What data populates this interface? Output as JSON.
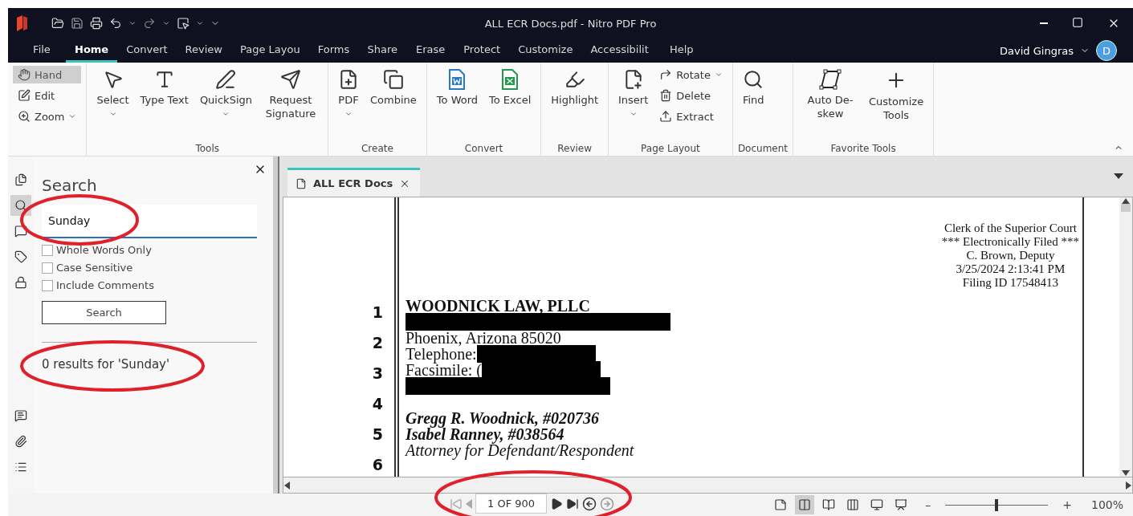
{
  "window": {
    "title": "ALL ECR Docs.pdf - Nitro PDF Pro",
    "user": "David Gingras",
    "avatar": "D"
  },
  "menu_tabs": [
    {
      "label": "File",
      "selected": false
    },
    {
      "label": "Home",
      "selected": true
    },
    {
      "label": "Convert",
      "selected": false
    },
    {
      "label": "Review",
      "selected": false
    },
    {
      "label": "Page Layou",
      "selected": false
    },
    {
      "label": "Forms",
      "selected": false
    },
    {
      "label": "Share",
      "selected": false
    },
    {
      "label": "Erase",
      "selected": false
    },
    {
      "label": "Protect",
      "selected": false
    },
    {
      "label": "Customize",
      "selected": false
    },
    {
      "label": "Accessibilit",
      "selected": false
    },
    {
      "label": "Help",
      "selected": false
    }
  ],
  "ribbon_groups": [
    {
      "buttons": [
        {
          "kind": "small",
          "label": "Hand",
          "selected": true,
          "dropdown": false
        },
        {
          "kind": "small",
          "label": "Edit",
          "selected": false,
          "dropdown": false
        },
        {
          "kind": "small",
          "label": "Zoom",
          "selected": false,
          "dropdown": true
        }
      ]
    },
    {
      "label": "Tools",
      "buttons": [
        {
          "kind": "large",
          "label": "Select",
          "dropdown": true
        },
        {
          "kind": "large",
          "label": "Type Text",
          "dropdown": false
        },
        {
          "kind": "large",
          "label": "QuickSign",
          "dropdown": true
        },
        {
          "kind": "large",
          "label": "Request Signature",
          "dropdown": false
        }
      ]
    },
    {
      "label": "Create",
      "buttons": [
        {
          "kind": "large",
          "label": "PDF",
          "dropdown": true
        },
        {
          "kind": "large",
          "label": "Combine",
          "dropdown": false
        }
      ]
    },
    {
      "label": "Convert",
      "buttons": [
        {
          "kind": "large",
          "label": "To Word",
          "dropdown": false
        },
        {
          "kind": "large",
          "label": "To Excel",
          "dropdown": false
        }
      ]
    },
    {
      "label": "Review",
      "buttons": [
        {
          "kind": "large",
          "label": "Highlight",
          "dropdown": false
        }
      ]
    },
    {
      "label": "Page Layout",
      "buttons": [
        {
          "kind": "large",
          "label": "Insert",
          "dropdown": true
        },
        {
          "kind": "small",
          "label": "Rotate",
          "selected": false,
          "dropdown": true
        },
        {
          "kind": "small",
          "label": "Delete",
          "selected": false,
          "dropdown": false
        },
        {
          "kind": "small",
          "label": "Extract",
          "selected": false,
          "dropdown": false
        }
      ]
    },
    {
      "label": "Document",
      "buttons": [
        {
          "kind": "large",
          "label": "Find",
          "dropdown": false
        }
      ]
    },
    {
      "label": "Favorite Tools",
      "buttons": [
        {
          "kind": "large",
          "label": "Auto De-skew",
          "dropdown": false
        },
        {
          "kind": "large",
          "label": "Customize Tools",
          "dropdown": false
        }
      ]
    }
  ],
  "side_strip": [
    {
      "selected": false
    },
    {
      "selected": true
    },
    {
      "selected": false
    },
    {
      "selected": false
    },
    {
      "selected": false
    }
  ],
  "side_strip_bottom": [
    {
      "selected": false
    },
    {
      "selected": false
    },
    {
      "selected": false
    }
  ],
  "search_panel": {
    "title": "Search",
    "query": "Sunday",
    "options": [
      {
        "label": "Whole Words Only",
        "checked": false
      },
      {
        "label": "Case Sensitive",
        "checked": false
      },
      {
        "label": "Include Comments",
        "checked": false
      }
    ],
    "button": "Search",
    "result": "0 results for 'Sunday'"
  },
  "document_tab": {
    "label": "ALL ECR Docs",
    "selected": true
  },
  "page": {
    "header": [
      "Clerk of the Superior Court",
      "*** Electronically Filed ***",
      "C. Brown, Deputy",
      "3/25/2024 2:13:41 PM",
      "Filing ID 17548413"
    ],
    "line_numbers": [
      "1",
      "2",
      "3",
      "4",
      "5",
      "6"
    ],
    "lines": [
      {
        "kind": "bold",
        "text": "WOODNICK LAW, PLLC"
      },
      {
        "kind": "redaction"
      },
      {
        "kind": "plain",
        "text": "Phoenix, Arizona 85020"
      },
      {
        "kind": "plain",
        "text": "Telephone:",
        "redacted_after": true
      },
      {
        "kind": "plain",
        "text": "Facsimile: (",
        "redacted_after": true
      },
      {
        "kind": "redaction"
      },
      {
        "kind": "gap"
      },
      {
        "kind": "bold_italic",
        "text": "Gregg R. Woodnick, #020736"
      },
      {
        "kind": "bold_italic",
        "text": "Isabel Ranney, #038564"
      },
      {
        "kind": "italic",
        "text": "Attorney for Defendant/Respondent"
      }
    ]
  },
  "status_bar": {
    "page": "1 OF 900",
    "view_modes": [
      {
        "selected": false
      },
      {
        "selected": true
      },
      {
        "selected": false
      },
      {
        "selected": false
      },
      {
        "selected": false
      },
      {
        "selected": false
      }
    ],
    "zoom_minus": "–",
    "zoom_plus": "+",
    "zoom": {
      "level": 0.5
    },
    "zoom_reading": "100%"
  },
  "annotations": [
    {
      "kind": "ellipse",
      "color": "#e0202a"
    },
    {
      "kind": "ellipse",
      "color": "#e0202a"
    },
    {
      "kind": "ellipse",
      "color": "#e0202a"
    }
  ]
}
